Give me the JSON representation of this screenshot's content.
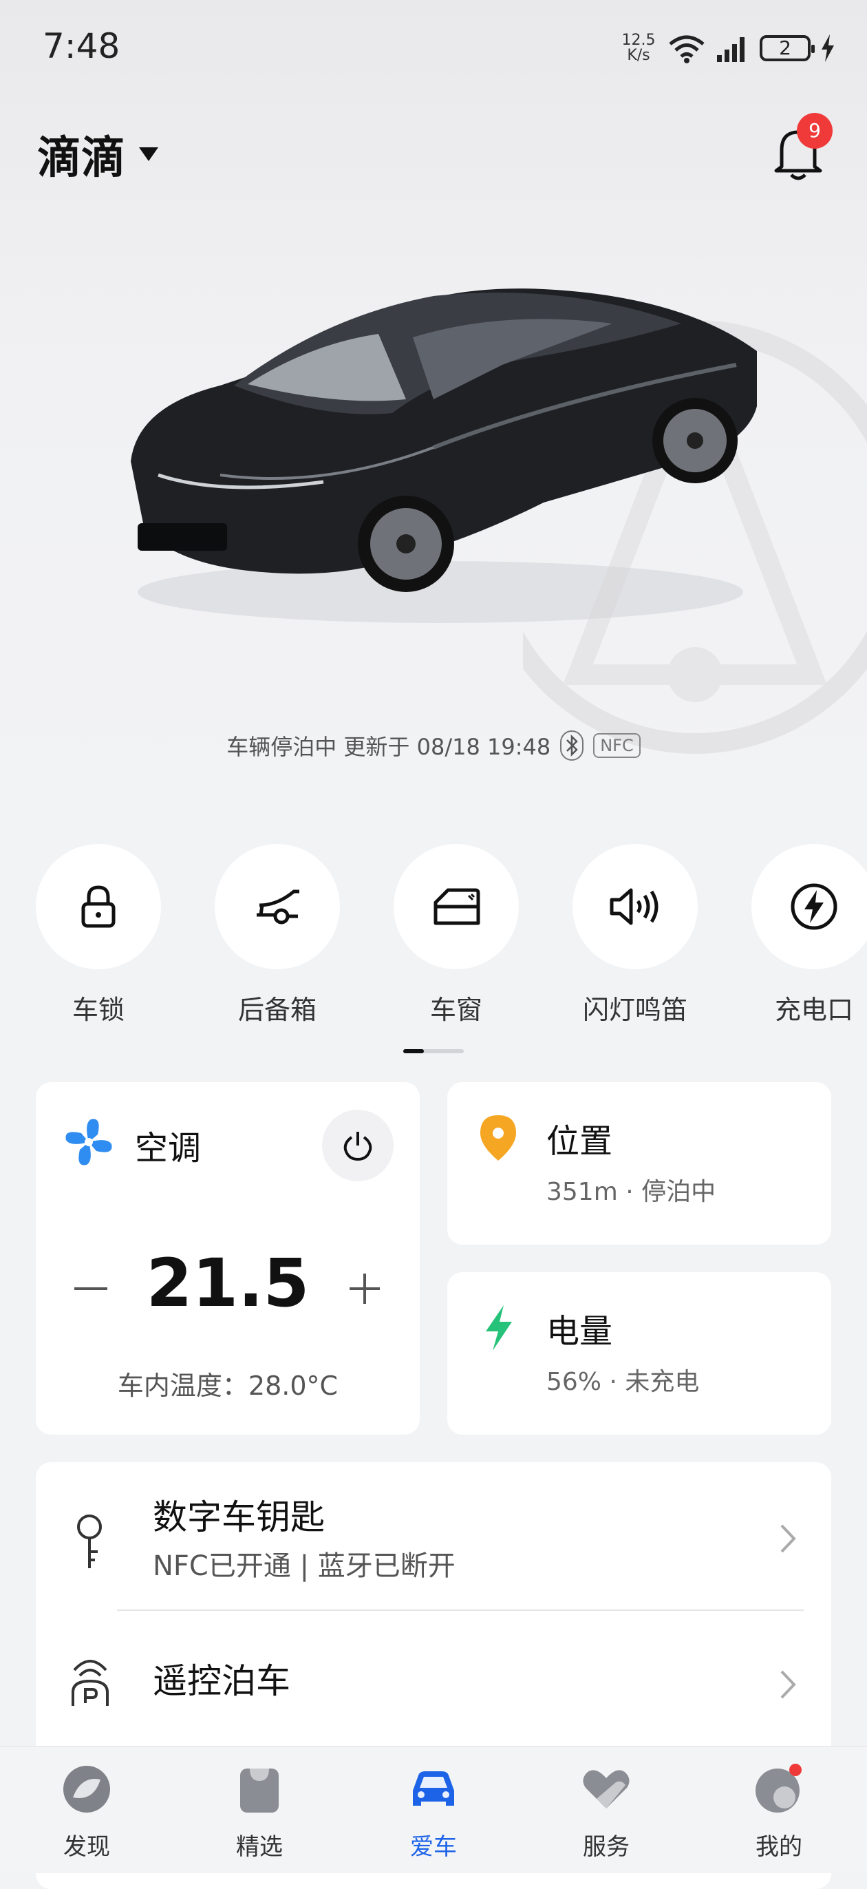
{
  "status_bar": {
    "time": "7:48",
    "net_speed_top": "12.5",
    "net_speed_bottom": "K/s",
    "battery": "2"
  },
  "header": {
    "account_name": "滴滴",
    "notification_count": "9"
  },
  "vehicle_status": {
    "text": "车辆停泊中 更新于 08/18 19:48",
    "nfc_label": "NFC"
  },
  "quick_actions": [
    {
      "label": "车锁",
      "icon": "lock-icon"
    },
    {
      "label": "后备箱",
      "icon": "trunk-icon"
    },
    {
      "label": "车窗",
      "icon": "window-icon"
    },
    {
      "label": "闪灯鸣笛",
      "icon": "horn-icon"
    },
    {
      "label": "充电口",
      "icon": "charge-port-icon"
    }
  ],
  "climate": {
    "title": "空调",
    "temperature": "21.5",
    "minus": "—",
    "plus": "+",
    "inside_temp": "车内温度：28.0°C",
    "accent": "#2f8cf0"
  },
  "location": {
    "title": "位置",
    "subtitle": "351m · 停泊中",
    "accent": "#f5a623"
  },
  "battery": {
    "title": "电量",
    "subtitle": "56% · 未充电",
    "accent": "#27c27a"
  },
  "list": [
    {
      "title": "数字车钥匙",
      "subtitle": "NFC已开通 | 蓝牙已断开",
      "icon": "key-icon"
    },
    {
      "title": "遥控泊车",
      "subtitle": "",
      "icon": "remote-parking-icon"
    }
  ],
  "bottom_nav": [
    {
      "label": "发现",
      "icon": "discover-icon"
    },
    {
      "label": "精选",
      "icon": "shopping-bag-icon"
    },
    {
      "label": "爱车",
      "icon": "car-icon",
      "active": true
    },
    {
      "label": "服务",
      "icon": "service-heart-icon"
    },
    {
      "label": "我的",
      "icon": "profile-icon"
    }
  ],
  "colors": {
    "active_nav": "#1d63e8",
    "badge": "#f03a3a",
    "background": "#f2f3f5"
  }
}
